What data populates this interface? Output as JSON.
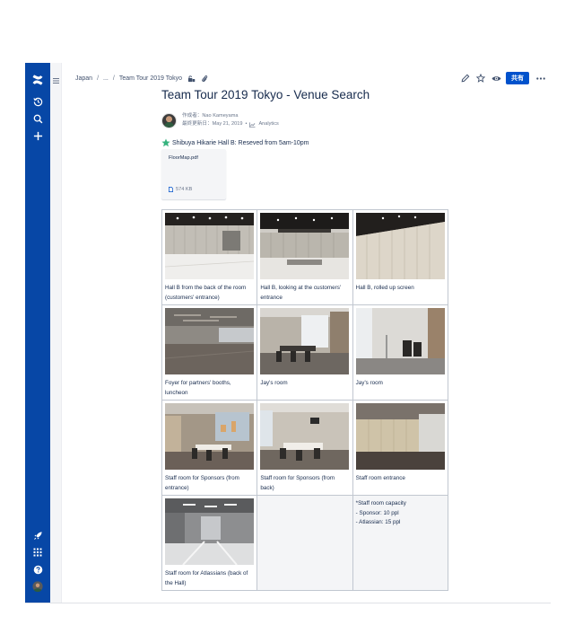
{
  "breadcrumb": {
    "space": "Japan",
    "ellipsis": "...",
    "current": "Team Tour 2019 Tokyo"
  },
  "header": {
    "share_label": "共有"
  },
  "page": {
    "title": "Team Tour 2019 Tokyo - Venue Search",
    "author_label": "作成者：Nao Kameyama",
    "updated_label": "最終更新日：May 21, 2019",
    "analytics_label": "Analytics",
    "reserve_note": "Shibuya Hikarie Hall B: Reseved from 5am-10pm"
  },
  "attachment": {
    "name": "FloorMap.pdf",
    "size": "574 KB"
  },
  "table": {
    "rows": [
      [
        {
          "caption": "Hall B from the back of the room (customers' entrance)"
        },
        {
          "caption": "Hall B, looking at the customers' entrance"
        },
        {
          "caption": "Hall B, rolled up screen"
        }
      ],
      [
        {
          "caption": "Foyer for partners' booths, luncheon"
        },
        {
          "caption": "Jay's room"
        },
        {
          "caption": "Jay's room"
        }
      ],
      [
        {
          "caption": "Staff room for Sponsors (from entrance)"
        },
        {
          "caption": "Staff room for Sponsors (from back)"
        },
        {
          "caption": "Staff room entrance"
        }
      ],
      [
        {
          "caption": "Staff room for Atlassians (back of the Hall)"
        }
      ]
    ],
    "note_lines": [
      "*Staff room capacity",
      "- Sponsor: 10 ppl",
      "- Atlassian: 15 ppl"
    ]
  },
  "colors": {
    "nav_bg": "#0747A6",
    "primary": "#0052CC",
    "text": "#172B4D",
    "subtle": "#6B778C",
    "star": "#36B37E"
  },
  "icons": {
    "nav": [
      "confluence-logo-icon",
      "recent-icon",
      "search-icon",
      "create-icon",
      "rocket-icon",
      "app-switcher-icon",
      "help-icon",
      "user-avatar"
    ],
    "header": [
      "edit-icon",
      "star-icon",
      "watch-icon",
      "more-icon"
    ]
  }
}
